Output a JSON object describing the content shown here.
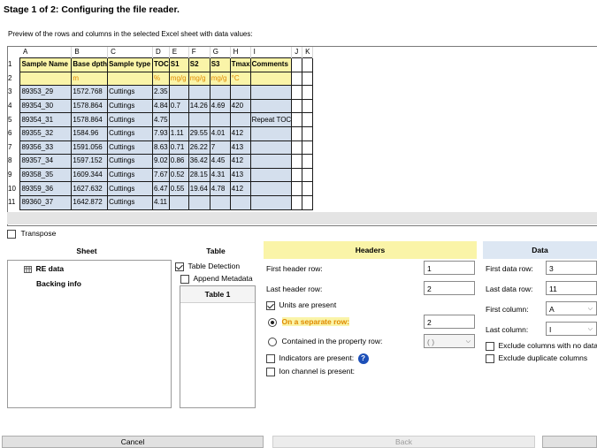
{
  "header": {
    "title": "Stage 1 of 2: Configuring the file reader.",
    "subtitle": "Preview of the rows and columns in the selected Excel sheet with data values:"
  },
  "grid": {
    "column_letters": [
      "A",
      "B",
      "C",
      "D",
      "E",
      "F",
      "G",
      "H",
      "I",
      "J",
      "K"
    ],
    "row_numbers": [
      "1",
      "2",
      "3",
      "4",
      "5",
      "6",
      "7",
      "8",
      "9",
      "10",
      "11"
    ],
    "rows": [
      [
        "Sample Name",
        "Base dpth",
        "Sample type",
        "TOC",
        "S1",
        "S2",
        "S3",
        "Tmax",
        "Comments",
        "",
        ""
      ],
      [
        "",
        "m",
        "",
        "%",
        "mg/g",
        "mg/g",
        "mg/g",
        "°C",
        "",
        "",
        ""
      ],
      [
        "89353_29",
        "1572.768",
        "Cuttings",
        "2.35",
        "",
        "",
        "",
        "",
        "",
        "",
        ""
      ],
      [
        "89354_30",
        "1578.864",
        "Cuttings",
        "4.84",
        "0.7",
        "14.26",
        "4.69",
        "420",
        "",
        "",
        ""
      ],
      [
        "89354_31",
        "1578.864",
        "Cuttings",
        "4.75",
        "",
        "",
        "",
        "",
        "Repeat TOC",
        "",
        ""
      ],
      [
        "89355_32",
        "1584.96",
        "Cuttings",
        "7.93",
        "1.11",
        "29.55",
        "4.01",
        "412",
        "",
        "",
        ""
      ],
      [
        "89356_33",
        "1591.056",
        "Cuttings",
        "8.63",
        "0.71",
        "26.22",
        "7",
        "413",
        "",
        "",
        ""
      ],
      [
        "89357_34",
        "1597.152",
        "Cuttings",
        "9.02",
        "0.86",
        "36.42",
        "4.45",
        "412",
        "",
        "",
        ""
      ],
      [
        "89358_35",
        "1609.344",
        "Cuttings",
        "7.67",
        "0.52",
        "28.15",
        "4.31",
        "413",
        "",
        "",
        ""
      ],
      [
        "89359_36",
        "1627.632",
        "Cuttings",
        "6.47",
        "0.55",
        "19.64",
        "4.78",
        "412",
        "",
        "",
        ""
      ],
      [
        "89360_37",
        "1642.872",
        "Cuttings",
        "4.11",
        "",
        "",
        "",
        "",
        "",
        "",
        ""
      ]
    ]
  },
  "transpose": {
    "label": "Transpose",
    "checked": false
  },
  "sheet": {
    "heading": "Sheet",
    "items": [
      {
        "label": "RE data",
        "icon": "table-icon",
        "selected": true
      },
      {
        "label": "Backing info",
        "icon": "",
        "selected": false
      }
    ]
  },
  "table": {
    "heading": "Table",
    "table_detection_label": "Table Detection",
    "append_metadata_label": "Append Metadata",
    "list_header": "Table 1"
  },
  "headers": {
    "heading": "Headers",
    "first_header_row_label": "First header row:",
    "first_header_row_value": "1",
    "last_header_row_label": "Last header row:",
    "last_header_row_value": "2",
    "units_present_label": "Units are present",
    "separate_row_label": "On a separate row:",
    "separate_row_value": "2",
    "property_row_label": "Contained in the property row:",
    "property_row_value": "( )",
    "indicators_label": "Indicators are present:",
    "ion_channel_label": "Ion channel is present:"
  },
  "data": {
    "heading": "Data",
    "first_data_row_label": "First data row:",
    "first_data_row_value": "3",
    "last_data_row_label": "Last data row:",
    "last_data_row_value": "11",
    "first_column_label": "First column:",
    "first_column_value": "A",
    "last_column_label": "Last column:",
    "last_column_value": "I",
    "exclude_no_data_label": "Exclude columns with no data",
    "exclude_duplicate_label": "Exclude duplicate columns"
  },
  "footer": {
    "cancel_label": "Cancel",
    "back_label": "Back"
  },
  "colors": {
    "header_highlight": "#faf4a8",
    "data_highlight": "#d4dfed",
    "units_text": "#e08a00",
    "data_panel_header": "#dde7f3"
  }
}
